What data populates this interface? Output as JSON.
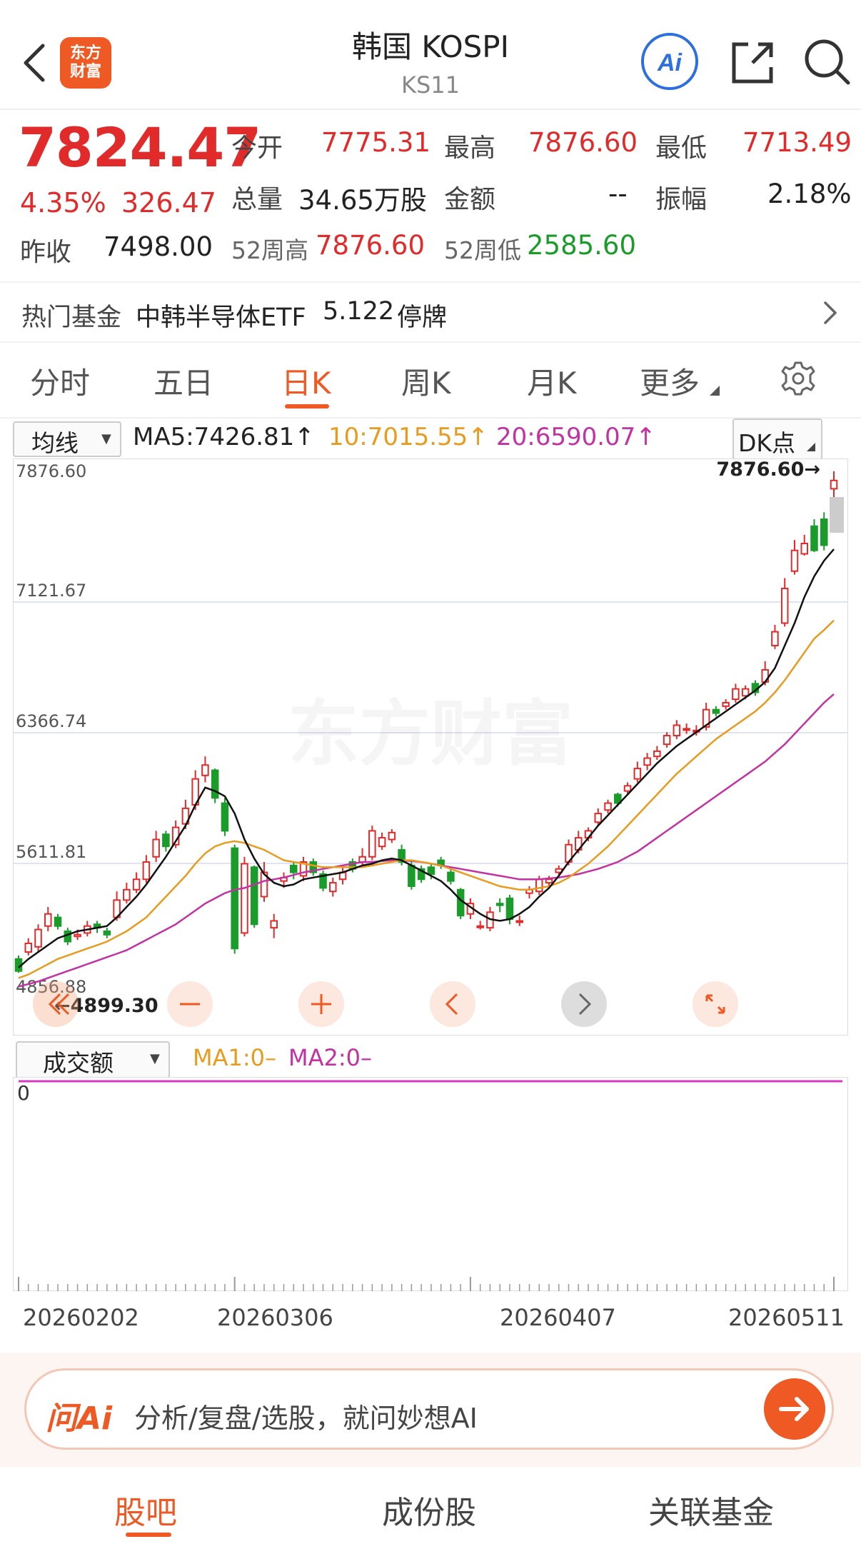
{
  "header": {
    "back_icon": "chevron-left-icon",
    "logo_line1": "东方",
    "logo_line2": "财富",
    "title": "韩国 KOSPI",
    "subtitle": "KS11",
    "ai_icon": "ai-icon",
    "share_icon": "share-icon",
    "search_icon": "search-icon"
  },
  "quote": {
    "price": "7824.47",
    "change_pct": "4.35%",
    "change_abs": "326.47",
    "open_label": "今开",
    "open": "7775.31",
    "high_label": "最高",
    "high": "7876.60",
    "low_label": "最低",
    "low": "7713.49",
    "volume_label": "总量",
    "volume": "34.65万股",
    "amount_label": "金额",
    "amount": "--",
    "amplitude_label": "振幅",
    "amplitude": "2.18%",
    "prev_close_label": "昨收",
    "prev_close": "7498.00",
    "week52_high_label": "52周高",
    "week52_high": "7876.60",
    "week52_low_label": "52周低",
    "week52_low": "2585.60"
  },
  "hot_fund": {
    "label": "热门基金",
    "name": "中韩半导体ETF",
    "value": "5.122",
    "status": "停牌"
  },
  "tabs": [
    "分时",
    "五日",
    "日K",
    "周K",
    "月K",
    "更多"
  ],
  "active_tab": "日K",
  "indicators": {
    "ma_select": "均线",
    "ma5": "MA5:7426.81↑",
    "ma10": "10:7015.55↑",
    "ma20": "20:6590.07↑",
    "dk_button": "DK点"
  },
  "colors": {
    "up": "#e12b2b",
    "down": "#1a9c2a",
    "ma5": "#111111",
    "ma10": "#e89b1e",
    "ma20": "#c332a3",
    "accent": "#ef5a24"
  },
  "chart_data": {
    "type": "candlestick",
    "y_ticks": [
      "7876.60",
      "7121.67",
      "6366.74",
      "5611.81",
      "4856.88"
    ],
    "ylim": [
      4856.88,
      7876.6
    ],
    "max_marker": "7876.60→",
    "min_marker": "←4899.30",
    "watermark": "东方财富",
    "x_labels": [
      "20260202",
      "20260306",
      "20260407",
      "20260511"
    ],
    "candles": [
      [
        5060,
        4990,
        5080,
        4980
      ],
      [
        5100,
        5150,
        5180,
        5080
      ],
      [
        5130,
        5230,
        5260,
        5100
      ],
      [
        5250,
        5320,
        5360,
        5220
      ],
      [
        5300,
        5250,
        5320,
        5230
      ],
      [
        5220,
        5160,
        5240,
        5140
      ],
      [
        5190,
        5200,
        5230,
        5170
      ],
      [
        5210,
        5250,
        5280,
        5190
      ],
      [
        5260,
        5240,
        5280,
        5210
      ],
      [
        5220,
        5200,
        5240,
        5180
      ],
      [
        5300,
        5400,
        5450,
        5280
      ],
      [
        5400,
        5460,
        5500,
        5380
      ],
      [
        5460,
        5520,
        5560,
        5440
      ],
      [
        5520,
        5620,
        5660,
        5500
      ],
      [
        5650,
        5750,
        5800,
        5620
      ],
      [
        5780,
        5710,
        5800,
        5680
      ],
      [
        5720,
        5820,
        5860,
        5700
      ],
      [
        5840,
        5930,
        5980,
        5810
      ],
      [
        5950,
        6100,
        6150,
        5920
      ],
      [
        6120,
        6180,
        6230,
        6080
      ],
      [
        6150,
        5990,
        6160,
        5960
      ],
      [
        5960,
        5800,
        5990,
        5770
      ],
      [
        5700,
        5120,
        5720,
        5090
      ],
      [
        5210,
        5610,
        5650,
        5190
      ],
      [
        5590,
        5260,
        5600,
        5240
      ],
      [
        5420,
        5560,
        5620,
        5390
      ],
      [
        5240,
        5280,
        5320,
        5180
      ],
      [
        5510,
        5530,
        5560,
        5470
      ],
      [
        5600,
        5560,
        5620,
        5520
      ],
      [
        5540,
        5620,
        5650,
        5510
      ],
      [
        5620,
        5560,
        5640,
        5540
      ],
      [
        5550,
        5470,
        5570,
        5450
      ],
      [
        5450,
        5500,
        5530,
        5420
      ],
      [
        5520,
        5560,
        5600,
        5490
      ],
      [
        5620,
        5580,
        5640,
        5560
      ],
      [
        5620,
        5650,
        5700,
        5600
      ],
      [
        5650,
        5800,
        5830,
        5630
      ],
      [
        5710,
        5760,
        5790,
        5690
      ],
      [
        5750,
        5790,
        5810,
        5730
      ],
      [
        5690,
        5620,
        5720,
        5600
      ],
      [
        5600,
        5480,
        5620,
        5460
      ],
      [
        5580,
        5520,
        5600,
        5500
      ],
      [
        5590,
        5550,
        5610,
        5520
      ],
      [
        5630,
        5600,
        5650,
        5580
      ],
      [
        5560,
        5510,
        5580,
        5490
      ],
      [
        5460,
        5310,
        5470,
        5290
      ],
      [
        5320,
        5380,
        5410,
        5290
      ],
      [
        5250,
        5250,
        5280,
        5230
      ],
      [
        5240,
        5330,
        5360,
        5220
      ],
      [
        5380,
        5370,
        5410,
        5330
      ],
      [
        5410,
        5290,
        5430,
        5260
      ],
      [
        5280,
        5280,
        5310,
        5250
      ],
      [
        5440,
        5460,
        5480,
        5410
      ],
      [
        5450,
        5520,
        5540,
        5430
      ],
      [
        5500,
        5520,
        5540,
        5480
      ],
      [
        5560,
        5580,
        5600,
        5540
      ],
      [
        5620,
        5720,
        5750,
        5600
      ],
      [
        5690,
        5760,
        5800,
        5670
      ],
      [
        5760,
        5800,
        5820,
        5740
      ],
      [
        5850,
        5900,
        5930,
        5830
      ],
      [
        5920,
        5960,
        5980,
        5900
      ],
      [
        6010,
        5960,
        6020,
        5940
      ],
      [
        6030,
        6060,
        6080,
        6010
      ],
      [
        6100,
        6160,
        6200,
        6080
      ],
      [
        6180,
        6220,
        6250,
        6150
      ],
      [
        6230,
        6260,
        6290,
        6210
      ],
      [
        6300,
        6350,
        6370,
        6280
      ],
      [
        6350,
        6410,
        6440,
        6330
      ],
      [
        6390,
        6390,
        6420,
        6360
      ],
      [
        6380,
        6380,
        6410,
        6350
      ],
      [
        6400,
        6500,
        6540,
        6380
      ],
      [
        6500,
        6480,
        6520,
        6460
      ],
      [
        6520,
        6540,
        6560,
        6500
      ],
      [
        6560,
        6620,
        6650,
        6540
      ],
      [
        6580,
        6620,
        6640,
        6560
      ],
      [
        6650,
        6600,
        6670,
        6580
      ],
      [
        6660,
        6730,
        6780,
        6640
      ],
      [
        6870,
        6950,
        6990,
        6850
      ],
      [
        7000,
        7200,
        7260,
        6980
      ],
      [
        7300,
        7420,
        7480,
        7280
      ],
      [
        7400,
        7460,
        7510,
        7390
      ],
      [
        7560,
        7420,
        7600,
        7410
      ],
      [
        7600,
        7450,
        7640,
        7420
      ],
      [
        7776,
        7824,
        7877,
        7713
      ]
    ],
    "ma5": [
      5010,
      5060,
      5100,
      5140,
      5180,
      5200,
      5220,
      5230,
      5240,
      5250,
      5300,
      5360,
      5420,
      5490,
      5570,
      5650,
      5740,
      5830,
      5950,
      6050,
      6030,
      6000,
      5900,
      5750,
      5640,
      5550,
      5500,
      5480,
      5490,
      5520,
      5530,
      5540,
      5550,
      5560,
      5580,
      5600,
      5610,
      5630,
      5640,
      5630,
      5600,
      5570,
      5540,
      5510,
      5460,
      5400,
      5360,
      5320,
      5290,
      5280,
      5290,
      5320,
      5360,
      5420,
      5470,
      5540,
      5620,
      5690,
      5760,
      5830,
      5890,
      5950,
      6010,
      6070,
      6130,
      6190,
      6240,
      6290,
      6330,
      6370,
      6410,
      6450,
      6490,
      6530,
      6570,
      6610,
      6660,
      6740,
      6870,
      7000,
      7150,
      7270,
      7360,
      7426.81
    ],
    "ma10": [
      4950,
      4970,
      5000,
      5030,
      5060,
      5080,
      5100,
      5120,
      5140,
      5160,
      5190,
      5220,
      5260,
      5300,
      5360,
      5420,
      5480,
      5540,
      5610,
      5670,
      5710,
      5730,
      5740,
      5730,
      5710,
      5690,
      5660,
      5630,
      5620,
      5610,
      5600,
      5590,
      5590,
      5590,
      5590,
      5590,
      5600,
      5610,
      5620,
      5630,
      5630,
      5620,
      5610,
      5600,
      5580,
      5560,
      5540,
      5520,
      5500,
      5480,
      5470,
      5460,
      5460,
      5470,
      5480,
      5500,
      5530,
      5570,
      5610,
      5660,
      5710,
      5770,
      5830,
      5890,
      5950,
      6010,
      6070,
      6130,
      6180,
      6230,
      6280,
      6330,
      6370,
      6410,
      6450,
      6490,
      6540,
      6600,
      6670,
      6750,
      6830,
      6910,
      6960,
      7015.55
    ],
    "ma20": [
      4900,
      4915,
      4930,
      4950,
      4970,
      4990,
      5010,
      5030,
      5050,
      5070,
      5090,
      5110,
      5140,
      5170,
      5200,
      5230,
      5260,
      5300,
      5340,
      5380,
      5410,
      5440,
      5460,
      5470,
      5490,
      5510,
      5520,
      5530,
      5545,
      5560,
      5570,
      5580,
      5590,
      5600,
      5610,
      5620,
      5620,
      5625,
      5630,
      5630,
      5625,
      5620,
      5610,
      5600,
      5590,
      5580,
      5570,
      5560,
      5550,
      5540,
      5530,
      5520,
      5520,
      5520,
      5525,
      5530,
      5540,
      5550,
      5565,
      5580,
      5600,
      5620,
      5650,
      5680,
      5720,
      5760,
      5800,
      5840,
      5880,
      5920,
      5960,
      6000,
      6040,
      6080,
      6120,
      6160,
      6200,
      6250,
      6300,
      6360,
      6420,
      6480,
      6540,
      6590.07
    ]
  },
  "chart_controls": {
    "collapse_icon": "double-chevron-left-icon",
    "zoom_out_icon": "minus-icon",
    "zoom_in_icon": "plus-icon",
    "prev_icon": "chevron-left-icon",
    "next_icon": "chevron-right-icon",
    "fullscreen_icon": "expand-icon"
  },
  "volume": {
    "select": "成交额",
    "ma1": "MA1:0–",
    "ma2": "MA2:0–",
    "zero_label": "0"
  },
  "ai_bar": {
    "logo": "问Ai",
    "placeholder": "分析/复盘/选股，就问妙想AI",
    "go_icon": "arrow-right-icon"
  },
  "bottom_tabs": [
    "股吧",
    "成份股",
    "关联基金"
  ]
}
